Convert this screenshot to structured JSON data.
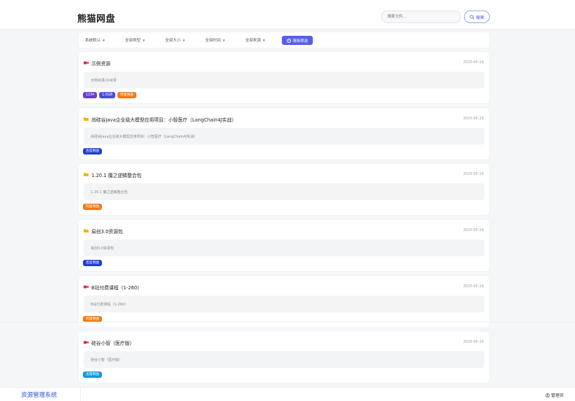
{
  "header": {
    "title": "熊猫网盘",
    "search_placeholder": "搜索文件...",
    "search_button": "搜索"
  },
  "filters": {
    "items": [
      {
        "label": "系统默认"
      },
      {
        "label": "全部类型"
      },
      {
        "label": "全部大小"
      },
      {
        "label": "全部时间"
      },
      {
        "label": "全部来源"
      }
    ],
    "clear_label": "清除筛选"
  },
  "colors": {
    "accent": "#5560e6",
    "tag_purple": "#6b3fc7",
    "tag_indigo": "#4b4fd8",
    "tag_orange": "#f07b16",
    "tag_blue": "#1f3fcf",
    "tag_sky": "#1098e0",
    "icon_video": "#e6293d",
    "icon_folder": "#f5b500"
  },
  "resources": [
    {
      "icon": "video-icon",
      "title": "示例资源",
      "date": "2025-05-19",
      "desc": "示例目录/子目录",
      "tags": [
        {
          "label": "1234",
          "color": "#6b3fc7"
        },
        {
          "label": "1.5GB",
          "color": "#4b4fd8"
        },
        {
          "label": "阿里网盘",
          "color": "#f07b16"
        }
      ]
    },
    {
      "icon": "folder-icon",
      "title": "尚硅谷Java企业级大模型应用项目：小智医疗（LangChain4J实战）",
      "date": "2025-05-19",
      "desc": "尚硅谷Java企业级大模型应用项目：小智医疗（LangChain4J实战）",
      "tags": [
        {
          "label": "百度网盘",
          "color": "#1f3fcf"
        }
      ]
    },
    {
      "icon": "folder-icon",
      "title": "1.20.1 魔之逆鳞整合包",
      "date": "2025-05-19",
      "desc": "1.20.1 魔之逆鳞整合包",
      "tags": [
        {
          "label": "阿里网盘",
          "color": "#f07b16"
        }
      ]
    },
    {
      "icon": "folder-icon",
      "title": "易创3.0资源包",
      "date": "2025-05-19",
      "desc": "易创3.0资源包",
      "tags": [
        {
          "label": "百度网盘",
          "color": "#1f3fcf"
        }
      ]
    },
    {
      "icon": "video-icon",
      "title": "B站付费课程（1-260）",
      "date": "2025-05-19",
      "desc": "B站付费课程（1-260）",
      "tags": [
        {
          "label": "阿里网盘",
          "color": "#f07b16"
        }
      ]
    },
    {
      "icon": "video-icon",
      "title": "硅谷小智（医疗版）",
      "date": "2025-05-19",
      "desc": "硅谷小智（医疗版）",
      "tags": [
        {
          "label": "迅雷网盘",
          "color": "#1098e0"
        }
      ]
    }
  ],
  "footer": {
    "brand": "资源管理系统",
    "user": "管理员"
  }
}
